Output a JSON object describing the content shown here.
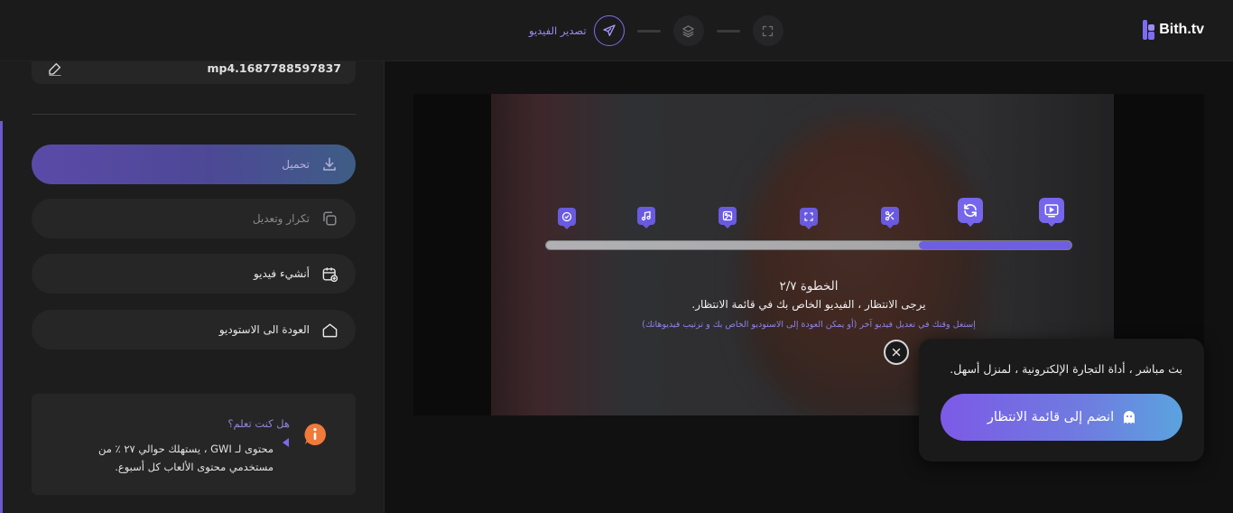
{
  "app": {
    "logo_text": "Bith.tv"
  },
  "topbar": {
    "export_label": "تصدير الفيديو",
    "icons": [
      "send-icon",
      "layers-icon",
      "fullscreen-icon"
    ]
  },
  "sidebar": {
    "filename": "mp4.1687788597837",
    "buttons": [
      {
        "label": "تحميل",
        "icon": "download-icon"
      },
      {
        "label": "تكرار وتعديل",
        "icon": "duplicate-icon"
      },
      {
        "label": "أنشيء فيديو",
        "icon": "calendar-add-icon"
      },
      {
        "label": "العودة الى الاستوديو",
        "icon": "home-icon"
      }
    ],
    "tip": {
      "title": "هل كنت تعلم؟",
      "text": "محتوى لـ GWI ، يستهلك حوالي ٢٧ ٪ من مستخدمي محتوى الألعاب كل أسبوع.",
      "icon": "info-icon"
    }
  },
  "progress": {
    "step_icons": [
      "check-icon",
      "music-icon",
      "image-icon",
      "focus-icon",
      "scissors-icon",
      "refresh-icon",
      "video-icon"
    ],
    "active_steps": 2,
    "total_steps": 7,
    "fill_fraction": 0.29,
    "step_count": "الخطوة ٢/٧",
    "message": "يرجى الانتظار ، الفيديو الخاص بك في قائمة الانتظار.",
    "hint": "إستغل وقتك في تعديل فيديو آخر (أو يمكن العودة إلى الاستوديو الخاص بك و ترتيب فيديوهاتك)"
  },
  "popup": {
    "text": "بث مباشر ، أداة التجارة الإلكترونية ، لمنزل أسهل.",
    "button_label": "انضم إلى قائمة الانتظار",
    "button_icon": "ghost-icon"
  },
  "colors": {
    "accent": "#7566ec",
    "background": "#111112",
    "panel": "#1d1d1e"
  }
}
